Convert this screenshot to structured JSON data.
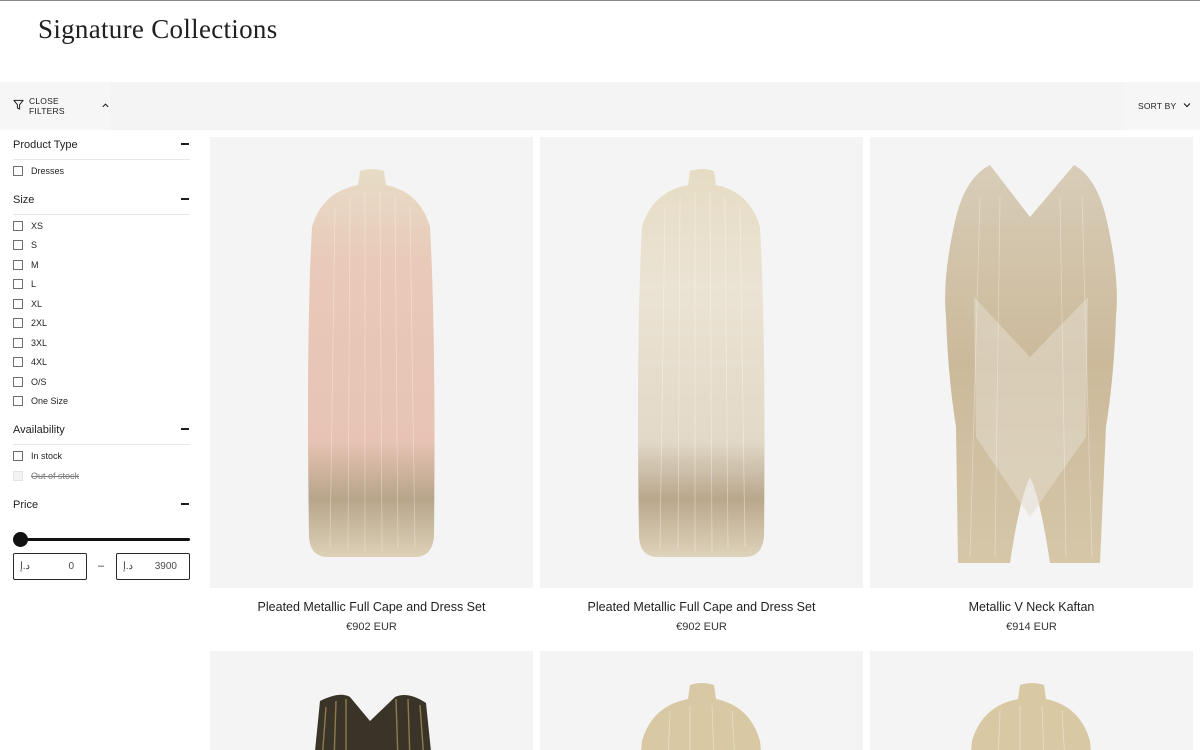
{
  "page": {
    "title": "Signature Collections"
  },
  "toolbar": {
    "close_filters_label": "CLOSE FILTERS",
    "sort_by_label": "SORT BY"
  },
  "filters": {
    "product_type": {
      "title": "Product Type",
      "options": [
        "Dresses"
      ]
    },
    "size": {
      "title": "Size",
      "options": [
        "XS",
        "S",
        "M",
        "L",
        "XL",
        "2XL",
        "3XL",
        "4XL",
        "O/S",
        "One Size"
      ]
    },
    "availability": {
      "title": "Availability",
      "options": [
        {
          "label": "In stock",
          "disabled": false
        },
        {
          "label": "Out of stock",
          "disabled": true
        }
      ]
    },
    "price": {
      "title": "Price",
      "currency_symbol": "د.إ",
      "min_value": "0",
      "max_value": "3900",
      "separator": "–"
    }
  },
  "products": [
    {
      "name": "Pleated Metallic Full Cape and Dress Set",
      "price": "€902 EUR",
      "tint": "#e9c9bc"
    },
    {
      "name": "Pleated Metallic Full Cape and Dress Set",
      "price": "€902 EUR",
      "tint": "#e7ddcd"
    },
    {
      "name": "Metallic V Neck Kaftan",
      "price": "€914 EUR",
      "tint": "#d9cbb4"
    },
    {
      "name": "",
      "price": "",
      "tint": "#3a3328"
    },
    {
      "name": "",
      "price": "",
      "tint": "#d8c9a4"
    },
    {
      "name": "",
      "price": "",
      "tint": "#d8c9a4"
    }
  ],
  "colors": {
    "toolbar_bg": "#f4f4f4",
    "card_bg": "#f4f4f4",
    "gold": "#c9b892",
    "text": "#1f1f1f"
  }
}
